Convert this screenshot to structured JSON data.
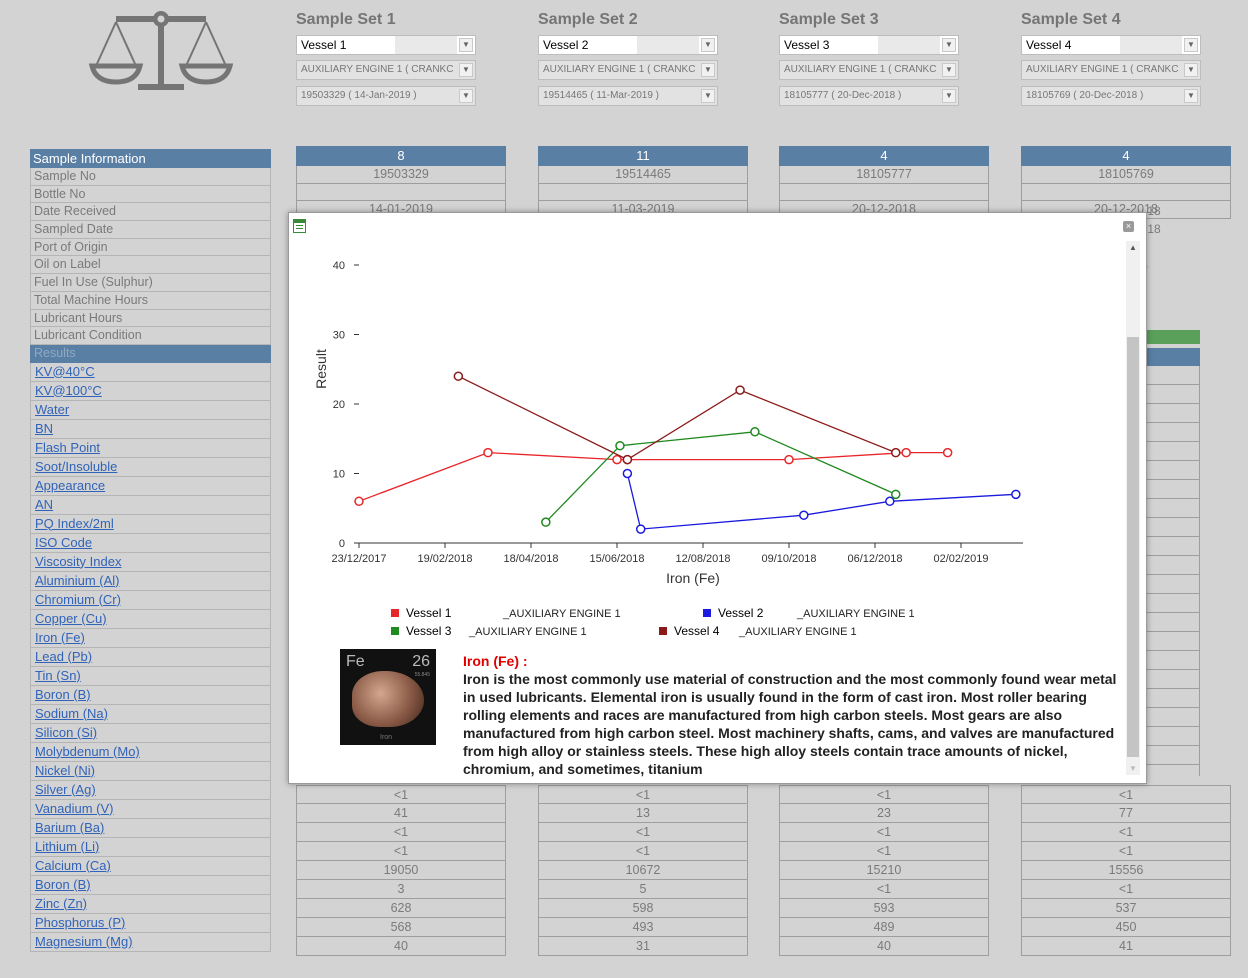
{
  "sample_sets": [
    {
      "title": "Sample Set 1",
      "vessel": "Vessel 1",
      "equipment": "AUXILIARY ENGINE 1 ( CRANKC",
      "sample": "19503329 ( 14-Jan-2019 )"
    },
    {
      "title": "Sample Set 2",
      "vessel": "Vessel 2",
      "equipment": "AUXILIARY ENGINE 1 ( CRANKC",
      "sample": "19514465 ( 11-Mar-2019 )"
    },
    {
      "title": "Sample Set 3",
      "vessel": "Vessel 3",
      "equipment": "AUXILIARY ENGINE 1 ( CRANKC",
      "sample": "18105777 ( 20-Dec-2018 )"
    },
    {
      "title": "Sample Set 4",
      "vessel": "Vessel 4",
      "equipment": "AUXILIARY ENGINE 1 ( CRANKC",
      "sample": "18105769 ( 20-Dec-2018 )"
    }
  ],
  "sample_info": {
    "header": "Sample Information",
    "rows": [
      "Sample No",
      "Bottle No",
      "Date Received",
      "Sampled Date",
      "Port of Origin",
      "Oil on Label",
      "Fuel In Use (Sulphur)",
      "Total Machine Hours",
      "Lubricant Hours",
      "Lubricant Condition"
    ],
    "results_header": "Results"
  },
  "results": [
    "KV@40°C",
    "KV@100°C",
    "Water",
    "BN",
    "Flash Point",
    "Soot/Insoluble",
    "Appearance",
    "AN",
    "PQ Index/2ml",
    "ISO Code",
    "Viscosity Index",
    "Aluminium (Al)",
    "Chromium (Cr)",
    "Copper (Cu)",
    "Iron (Fe)",
    "Lead (Pb)",
    "Tin (Sn)",
    "Boron (B)",
    "Sodium (Na)",
    "Silicon (Si)",
    "Molybdenum (Mo)",
    "Nickel (Ni)",
    "Silver (Ag)",
    "Vanadium (V)",
    "Barium (Ba)",
    "Lithium (Li)",
    "Calcium (Ca)",
    "Boron (B)",
    "Zinc (Zn)",
    "Phosphorus (P)",
    "Magnesium (Mg)"
  ],
  "columns": [
    {
      "head": "8",
      "sample_no": "19503329",
      "partial_date": "14-01-2019",
      "bottom": [
        "<1",
        "41",
        "<1",
        "<1",
        "19050",
        "3",
        "628",
        "568",
        "40"
      ]
    },
    {
      "head": "11",
      "sample_no": "19514465",
      "partial_date": "11-03-2019",
      "bottom": [
        "<1",
        "13",
        "<1",
        "<1",
        "10672",
        "5",
        "598",
        "493",
        "31"
      ]
    },
    {
      "head": "4",
      "sample_no": "18105777",
      "partial_date": "20-12-2018",
      "bottom": [
        "<1",
        "23",
        "<1",
        "<1",
        "15210",
        "<1",
        "593",
        "489",
        "40"
      ]
    },
    {
      "head": "4",
      "sample_no": "18105769",
      "partial_date": "20-12-2018",
      "bottom": [
        "<1",
        "77",
        "<1",
        "<1",
        "15556",
        "<1",
        "537",
        "450",
        "41"
      ]
    }
  ],
  "peek_text": [
    ".18",
    ".18",
    "",
    ")"
  ],
  "popup": {
    "info_title": "Iron (Fe) :",
    "info_text": "Iron is the most commonly use material of construction and the most commonly found wear metal in used lubricants. Elemental iron is usually found in the form of cast iron. Most roller bearing rolling elements and races are manufactured from high carbon steels. Most gears are also manufactured from high carbon steel. Most machinery shafts, cams, and valves are manufactured from high alloy or stainless steels. These high alloy steels contain trace amounts of nickel, chromium, and sometimes, titanium",
    "element_symbol": "Fe",
    "element_number": "26",
    "element_mass": "55.845",
    "element_name": "Iron"
  },
  "chart_data": {
    "type": "line",
    "xlabel": "Iron (Fe)",
    "ylabel": "Result",
    "ylim": [
      0,
      40
    ],
    "yticks": [
      0,
      10,
      20,
      30,
      40
    ],
    "x_tick_labels": [
      "23/12/2017",
      "19/02/2018",
      "18/04/2018",
      "15/06/2018",
      "12/08/2018",
      "09/10/2018",
      "06/12/2018",
      "02/02/2019"
    ],
    "grid": false,
    "series": [
      {
        "name": "Vessel 1",
        "legend_sub": "_AUXILIARY ENGINE 1",
        "color": "#e8262a",
        "points": [
          [
            "2017-12-23",
            6
          ],
          [
            "2018-03-20",
            13
          ],
          [
            "2018-06-15",
            12
          ],
          [
            "2018-06-22",
            12
          ],
          [
            "2018-10-09",
            12
          ],
          [
            "2018-12-27",
            13
          ],
          [
            "2019-01-24",
            13
          ]
        ]
      },
      {
        "name": "Vessel 2",
        "legend_sub": "_AUXILIARY ENGINE 1",
        "color": "#1a1ae0",
        "points": [
          [
            "2018-06-22",
            10
          ],
          [
            "2018-07-01",
            2
          ],
          [
            "2018-10-19",
            4
          ],
          [
            "2018-12-16",
            6
          ],
          [
            "2019-03-11",
            7
          ]
        ]
      },
      {
        "name": "Vessel 3",
        "legend_sub": "_AUXILIARY ENGINE 1",
        "color": "#1f8a1f",
        "points": [
          [
            "2018-04-28",
            3
          ],
          [
            "2018-06-17",
            14
          ],
          [
            "2018-09-16",
            16
          ],
          [
            "2018-12-20",
            7
          ]
        ]
      },
      {
        "name": "Vessel 4",
        "legend_sub": "_AUXILIARY ENGINE 1",
        "color": "#8b1a1a",
        "points": [
          [
            "2018-02-28",
            24
          ],
          [
            "2018-06-22",
            12
          ],
          [
            "2018-09-06",
            22
          ],
          [
            "2018-12-20",
            13
          ]
        ]
      }
    ]
  }
}
